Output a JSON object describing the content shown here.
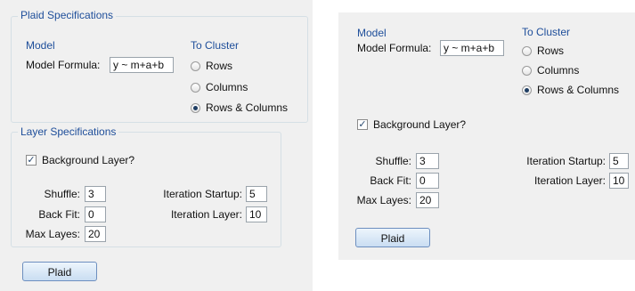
{
  "left": {
    "plaid_spec_title": "Plaid Specifications",
    "model_heading": "Model",
    "model_formula_label": "Model Formula:",
    "model_formula_value": "y ~ m+a+b",
    "cluster_heading": "To Cluster",
    "cluster_options": [
      "Rows",
      "Columns",
      "Rows & Columns"
    ],
    "layer_spec_title": "Layer Specifications",
    "background_layer_label": "Background Layer?",
    "shuffle_label": "Shuffle:",
    "shuffle_value": "3",
    "back_fit_label": "Back Fit:",
    "back_fit_value": "0",
    "max_layes_label": "Max Layes:",
    "max_layes_value": "20",
    "iteration_startup_label": "Iteration Startup:",
    "iteration_startup_value": "5",
    "iteration_layer_label": "Iteration Layer:",
    "iteration_layer_value": "10",
    "plaid_button": "Plaid"
  },
  "right": {
    "model_heading": "Model",
    "model_formula_label": "Model Formula:",
    "model_formula_value": "y ~ m+a+b",
    "cluster_heading": "To Cluster",
    "cluster_options": [
      "Rows",
      "Columns",
      "Rows & Columns"
    ],
    "background_layer_label": "Background Layer?",
    "shuffle_label": "Shuffle:",
    "shuffle_value": "3",
    "back_fit_label": "Back Fit:",
    "back_fit_value": "0",
    "max_layes_label": "Max Layes:",
    "max_layes_value": "20",
    "iteration_startup_label": "Iteration Startup:",
    "iteration_startup_value": "5",
    "iteration_layer_label": "Iteration Layer:",
    "iteration_layer_value": "10",
    "plaid_button": "Plaid"
  },
  "selected_cluster": "Rows & Columns",
  "background_layer_checked": true,
  "colors": {
    "heading_blue": "#1e4e9a",
    "panel_bg": "#f0f0f0",
    "group_border": "#d5dfe5"
  }
}
